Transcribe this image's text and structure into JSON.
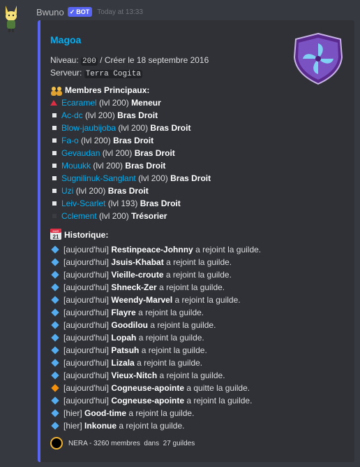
{
  "message": {
    "username": "Bwuno",
    "bot_badge": "BOT",
    "timestamp": "Today at 13:33"
  },
  "embed": {
    "accent_color": "#5865f2",
    "title": "Magoa",
    "level_label": "Niveau:",
    "level_value": "200",
    "created_text": "/ Créer le 18 septembre 2016",
    "server_label": "Serveur:",
    "server_value": "Terra Cogita",
    "members_title": "Membres Principaux:",
    "members": [
      {
        "icon": "red-triangle",
        "name": "Ecaramel",
        "level": "(lvl 200)",
        "role": "Meneur"
      },
      {
        "icon": "white-square",
        "name": "Ac-dc",
        "level": "(lvl 200)",
        "role": "Bras Droit"
      },
      {
        "icon": "white-square",
        "name": "Blow-jaubijoba",
        "level": "(lvl 200)",
        "role": "Bras Droit"
      },
      {
        "icon": "white-square",
        "name": "Fa-o",
        "level": "(lvl 200)",
        "role": "Bras Droit"
      },
      {
        "icon": "white-square",
        "name": "Gevaudan",
        "level": "(lvl 200)",
        "role": "Bras Droit"
      },
      {
        "icon": "white-square",
        "name": "Mouukk",
        "level": "(lvl 200)",
        "role": "Bras Droit"
      },
      {
        "icon": "white-square",
        "name": "Sugnilinuk-Sanglant",
        "level": "(lvl 200)",
        "role": "Bras Droit"
      },
      {
        "icon": "white-square",
        "name": "Uzi",
        "level": "(lvl 200)",
        "role": "Bras Droit"
      },
      {
        "icon": "white-square",
        "name": "Leiv-Scarlet",
        "level": "(lvl 193)",
        "role": "Bras Droit"
      },
      {
        "icon": "black-square",
        "name": "Cclement",
        "level": "(lvl 200)",
        "role": "Trésorier"
      }
    ],
    "history_title": "Historique:",
    "calendar_month": "MAR",
    "calendar_day": "21",
    "history": [
      {
        "icon": "blue-diamond",
        "when": "[aujourd'hui]",
        "who": "Restinpeace-Johnny",
        "action": "a rejoint la guilde."
      },
      {
        "icon": "blue-diamond",
        "when": "[aujourd'hui]",
        "who": "Jsuis-Khabat",
        "action": "a rejoint la guilde."
      },
      {
        "icon": "blue-diamond",
        "when": "[aujourd'hui]",
        "who": "Vieille-croute",
        "action": "a rejoint la guilde."
      },
      {
        "icon": "blue-diamond",
        "when": "[aujourd'hui]",
        "who": "Shneck-Zer",
        "action": "a rejoint la guilde."
      },
      {
        "icon": "blue-diamond",
        "when": "[aujourd'hui]",
        "who": "Weendy-Marvel",
        "action": "a rejoint la guilde."
      },
      {
        "icon": "blue-diamond",
        "when": "[aujourd'hui]",
        "who": "Flayre",
        "action": "a rejoint la guilde."
      },
      {
        "icon": "blue-diamond",
        "when": "[aujourd'hui]",
        "who": "Goodilou",
        "action": "a rejoint la guilde."
      },
      {
        "icon": "blue-diamond",
        "when": "[aujourd'hui]",
        "who": "Lopah",
        "action": "a rejoint la guilde."
      },
      {
        "icon": "blue-diamond",
        "when": "[aujourd'hui]",
        "who": "Patsuh",
        "action": "a rejoint la guilde."
      },
      {
        "icon": "blue-diamond",
        "when": "[aujourd'hui]",
        "who": "Lizala",
        "action": "a rejoint la guilde."
      },
      {
        "icon": "blue-diamond",
        "when": "[aujourd'hui]",
        "who": "Vieux-Nitch",
        "action": "a rejoint la guilde."
      },
      {
        "icon": "orange-diamond",
        "when": "[aujourd'hui]",
        "who": "Cogneuse-apointe",
        "action": "a quitte la guilde."
      },
      {
        "icon": "blue-diamond",
        "when": "[aujourd'hui]",
        "who": "Cogneuse-apointe",
        "action": "a rejoint la guilde."
      },
      {
        "icon": "blue-diamond",
        "when": "[hier]",
        "who": "Good-time",
        "action": "a rejoint la guilde."
      },
      {
        "icon": "blue-diamond",
        "when": "[hier]",
        "who": "Inkonue",
        "action": "a rejoint la guilde."
      }
    ],
    "footer": {
      "alliance": "NERA -",
      "members_count": "3260 membres",
      "sep": "dans",
      "guilds_count": "27 guildes"
    }
  }
}
